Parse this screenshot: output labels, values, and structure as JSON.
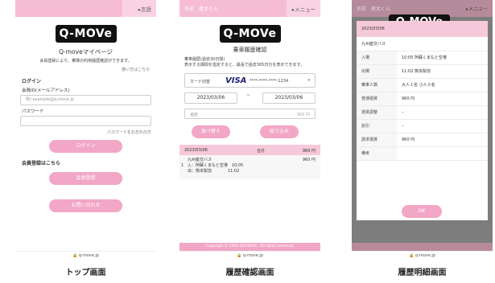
{
  "captions": [
    "トップ画面",
    "履歴確認画面",
    "履歴明細画面"
  ],
  "colors": {
    "accent_pink": "#f2a7c6",
    "header_pink": "#f6bcd4",
    "logo_black": "#111111"
  },
  "logo_text": "Q-MOVe",
  "footer_url": "q-move.jp",
  "top": {
    "menu": "▸言語",
    "title": "Q-moveマイページ",
    "desc": "会員登録により、乗降の利用履歴確認ができます。",
    "howto": "使い方はこちら",
    "login_heading": "ログイン",
    "id_label": "会員ID(メールアドレス)",
    "id_placeholder": "例) example@q-move.jp",
    "pw_label": "パスワード",
    "forgot": "パスワードをお忘れの方",
    "login_btn": "ログイン",
    "register_heading": "会員登録はこちら",
    "register_btn": "会員登録",
    "contact_btn": "お問い合わせ"
  },
  "history": {
    "user": "名前　産太くん",
    "menu": "▸メニュー",
    "page_title": "乗車履歴確認",
    "desc": "乗車履歴(過去30日間)\n表示する期間を指定すると、最長で過去365日分を表示できます。",
    "card_label": "カード切替",
    "card_brand": "VISA",
    "card_number": "****-****-****-1234",
    "caret": "▾",
    "date_from": "2023/03/06",
    "tilde": "~",
    "date_to": "2023/03/06",
    "total_label": "合計",
    "total_value": "960 円",
    "sort_btn": "並べ替え",
    "filter_btn": "絞り込み",
    "list_date": "2023/03/06",
    "list_total_label": "合計",
    "list_total_value": "960 円",
    "operator": "九州産交バス",
    "fare": "960 円",
    "count": "1",
    "in_line": "入：阿蘇くまもと空港　10:05",
    "out_line": "出：熊本駅前　　　　11:02",
    "copyright": "Copyright © 2020 QUADRAC. All rights reserved."
  },
  "detail": {
    "user": "名前　産太くん",
    "menu": "▸メニュー",
    "date": "2023/03/06",
    "operator": "九州産交バス",
    "rows": [
      {
        "k": "入場",
        "v": "10:05 阿蘇くまもと空港"
      },
      {
        "k": "出場",
        "v": "11:02 熊本駅前"
      },
      {
        "k": "乗車人数",
        "v": "大人１名 小人０名"
      },
      {
        "k": "普通運賃",
        "v": "960 円"
      },
      {
        "k": "運賃調整",
        "v": "–"
      },
      {
        "k": "割引",
        "v": "–"
      },
      {
        "k": "請求運賃",
        "v": "960 円"
      },
      {
        "k": "備考",
        "v": ""
      }
    ],
    "ok_btn": "OK"
  }
}
